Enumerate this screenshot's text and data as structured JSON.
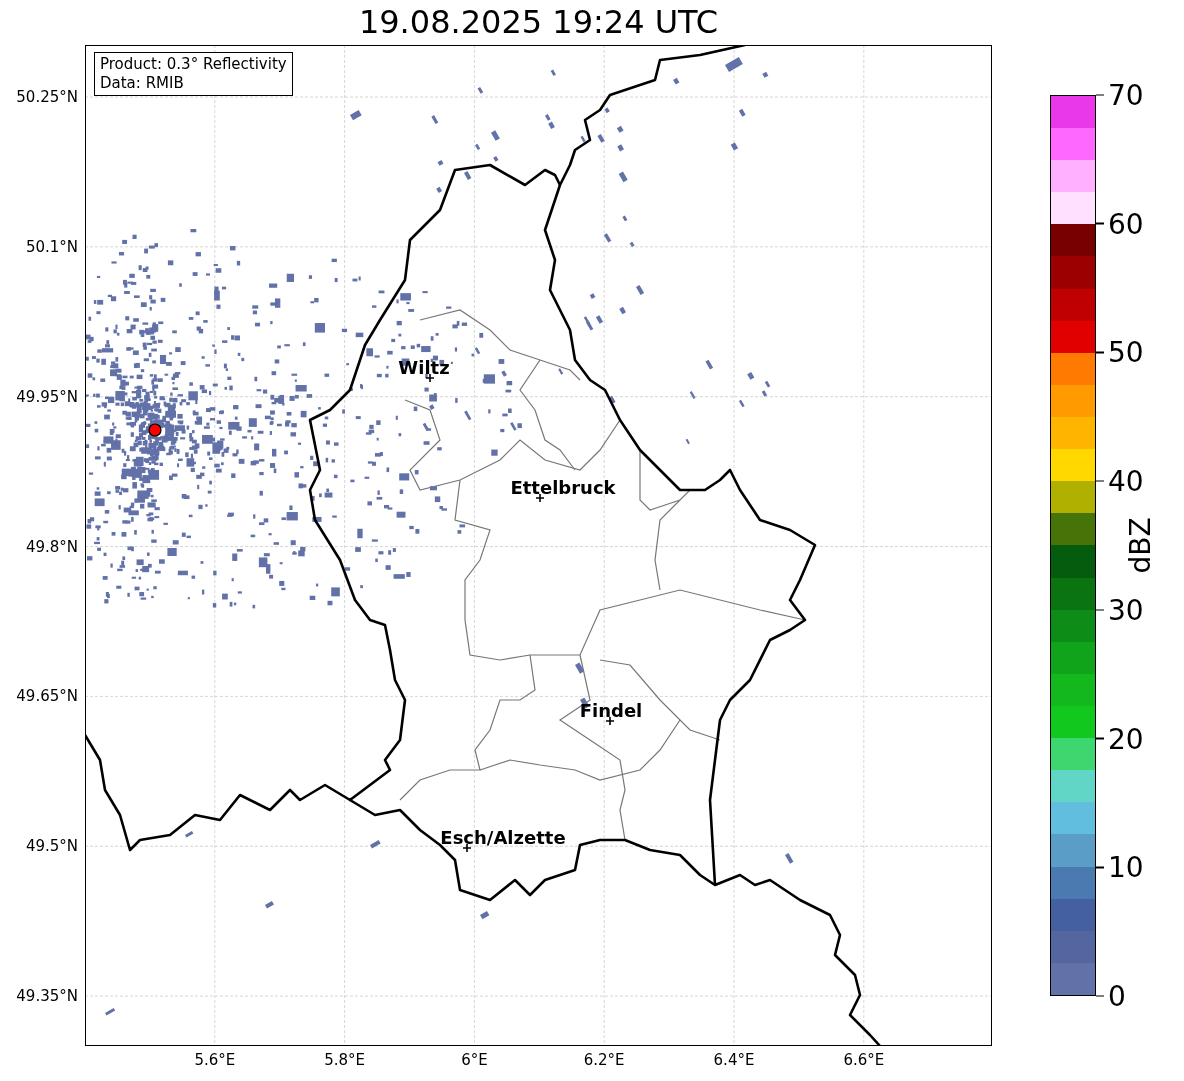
{
  "title": "19.08.2025 19:24 UTC",
  "info_box": [
    "Product: 0.3° Reflectivity",
    "Data: RMIB"
  ],
  "cities": [
    {
      "name": "Wiltz"
    },
    {
      "name": "Ettelbruck"
    },
    {
      "name": "Findel"
    },
    {
      "name": "Esch/Alzette"
    }
  ],
  "x_ticks": [
    "5.6°E",
    "5.8°E",
    "6°E",
    "6.2°E",
    "6.4°E",
    "6.6°E"
  ],
  "y_ticks": [
    "50.25°N",
    "50.1°N",
    "49.95°N",
    "49.8°N",
    "49.65°N",
    "49.5°N",
    "49.35°N"
  ],
  "colorbar": {
    "label": "dBZ",
    "ticks": [
      "70",
      "60",
      "50",
      "40",
      "30",
      "20",
      "10",
      "0"
    ],
    "segments": [
      {
        "color": "#6272a8"
      },
      {
        "color": "#5466a0"
      },
      {
        "color": "#4560a0"
      },
      {
        "color": "#4a7ab0"
      },
      {
        "color": "#5a9ec8"
      },
      {
        "color": "#62bede"
      },
      {
        "color": "#62d6c6"
      },
      {
        "color": "#3ed66e"
      },
      {
        "color": "#10c81e"
      },
      {
        "color": "#12b81c"
      },
      {
        "color": "#10a41a"
      },
      {
        "color": "#0e8c18"
      },
      {
        "color": "#0a7410"
      },
      {
        "color": "#065c0e"
      },
      {
        "color": "#467408"
      },
      {
        "color": "#b0b000"
      },
      {
        "color": "#ffd800"
      },
      {
        "color": "#ffb400"
      },
      {
        "color": "#ff9a00"
      },
      {
        "color": "#ff7a00"
      },
      {
        "color": "#e00000"
      },
      {
        "color": "#c00000"
      },
      {
        "color": "#9c0000"
      },
      {
        "color": "#780000"
      },
      {
        "color": "#ffe0ff"
      },
      {
        "color": "#ffb0ff"
      },
      {
        "color": "#ff68ff"
      },
      {
        "color": "#e838e8"
      }
    ]
  }
}
